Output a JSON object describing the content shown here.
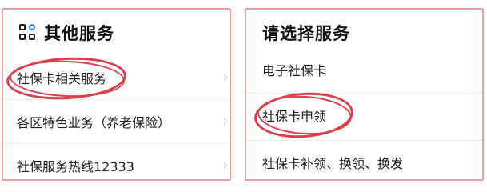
{
  "left": {
    "title": "其他服务",
    "items": [
      {
        "label": "社保卡相关服务"
      },
      {
        "label": "各区特色业务（养老保险）"
      },
      {
        "label": "社保服务热线12333"
      }
    ]
  },
  "right": {
    "title": "请选择服务",
    "items": [
      {
        "label": "电子社保卡"
      },
      {
        "label": "社保卡申领"
      },
      {
        "label": "社保卡补领、换领、换发"
      }
    ]
  },
  "colors": {
    "panel_border": "#ef9aa0",
    "highlight_circle": "#d9404b",
    "icon_accent": "#2f7fff"
  },
  "icons": [
    "grid-apps-icon",
    "chevron-right-icon"
  ]
}
